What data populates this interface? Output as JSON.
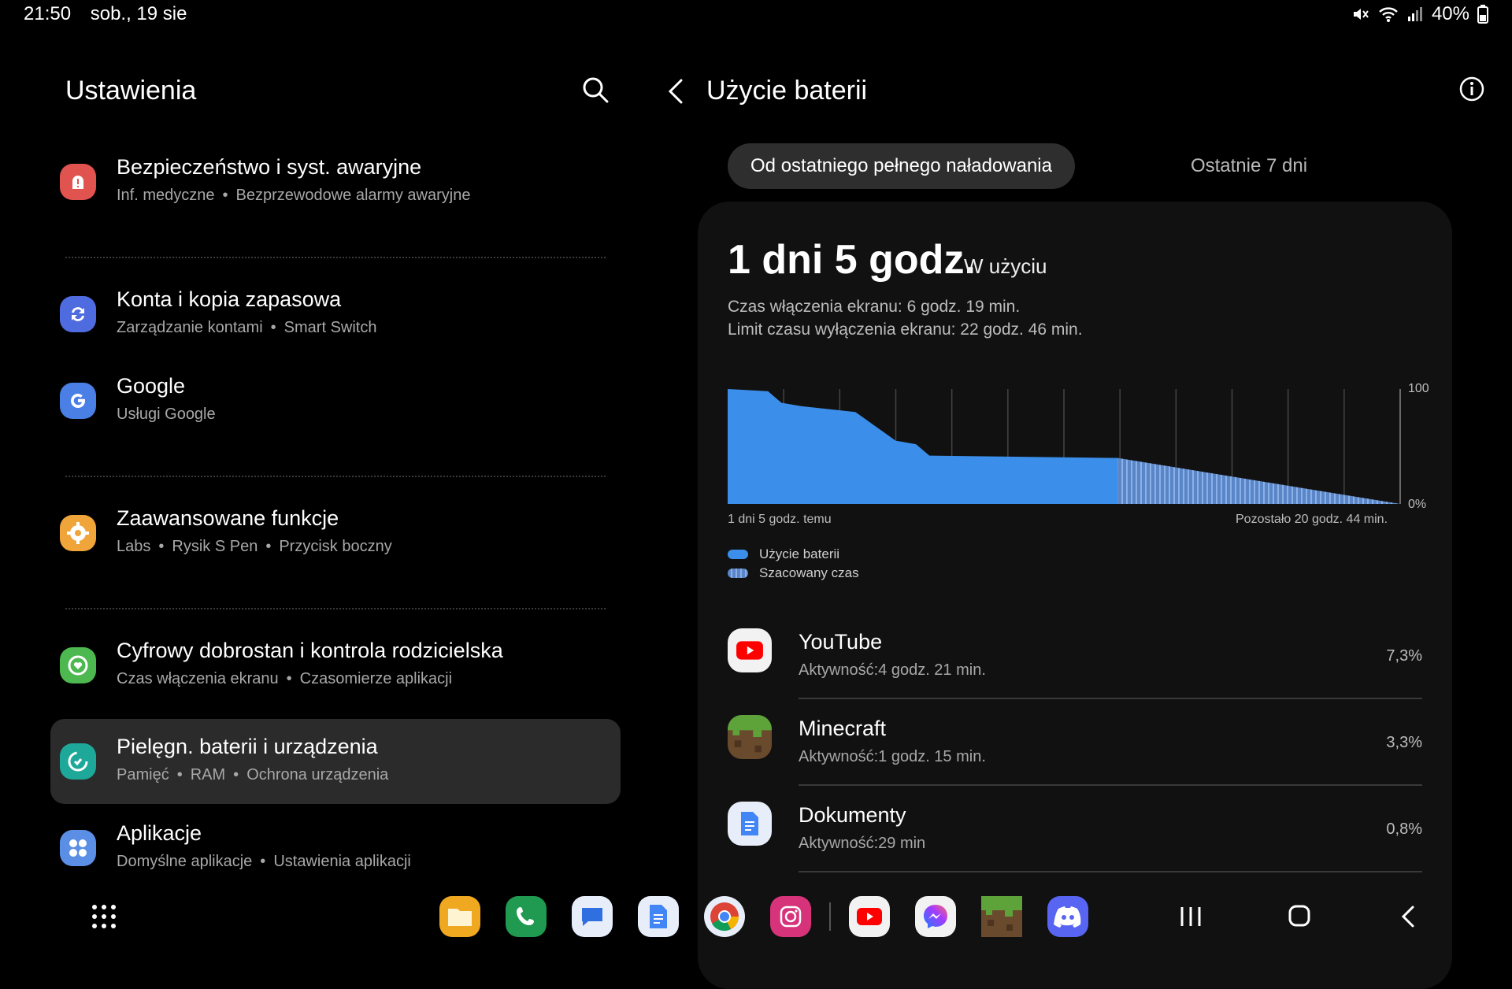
{
  "status": {
    "time": "21:50",
    "date": "sob., 19 sie",
    "battery": "40%",
    "icons": [
      "mute-icon",
      "wifi-icon",
      "signal-icon",
      "battery-icon"
    ]
  },
  "left": {
    "title": "Ustawienia",
    "search_icon": "search-icon",
    "items": [
      {
        "title": "Bezpieczeństwo i syst. awaryjne",
        "subs": [
          "Inf. medyczne",
          "Bezprzewodowe alarmy awaryjne"
        ],
        "icon": "emergency-icon",
        "color": "#e0534f"
      },
      {
        "title": "Konta i kopia zapasowa",
        "subs": [
          "Zarządzanie kontami",
          "Smart Switch"
        ],
        "icon": "sync-icon",
        "color": "#4f6be0"
      },
      {
        "title": "Google",
        "subs": [
          "Usługi Google"
        ],
        "icon": "google-icon",
        "color": "#4a7fe6"
      },
      {
        "title": "Zaawansowane funkcje",
        "subs": [
          "Labs",
          "Rysik S Pen",
          "Przycisk boczny"
        ],
        "icon": "gear-plus-icon",
        "color": "#f0a53a"
      },
      {
        "title": "Cyfrowy dobrostan i kontrola rodzicielska",
        "subs": [
          "Czas włączenia ekranu",
          "Czasomierze aplikacji"
        ],
        "icon": "wellbeing-icon",
        "color": "#4cb84f"
      },
      {
        "title": "Pielęgn. baterii i urządzenia",
        "subs": [
          "Pamięć",
          "RAM",
          "Ochrona urządzenia"
        ],
        "icon": "device-care-icon",
        "color": "#1ea89a"
      },
      {
        "title": "Aplikacje",
        "subs": [
          "Domyślne aplikacje",
          "Ustawienia aplikacji"
        ],
        "icon": "apps-icon",
        "color": "#5b8fe6"
      }
    ]
  },
  "right": {
    "title": "Użycie baterii",
    "tabs": [
      "Od ostatniego pełnego naładowania",
      "Ostatnie 7 dni"
    ],
    "usage_big": "1 dni 5 godz.",
    "usage_label": "W użyciu",
    "screen_on": "Czas włączenia ekranu: 6 godz. 19 min.",
    "screen_off": "Limit czasu wyłączenia ekranu: 22 godz. 46 min.",
    "chart_left_label": "1 dni 5 godz. temu",
    "chart_right_label": "Pozostało 20 godz. 44 min.",
    "y_top": "100",
    "y_bottom": "0%",
    "legend_usage": "Użycie baterii",
    "legend_estimate": "Szacowany czas",
    "apps": [
      {
        "name": "YouTube",
        "activity": "Aktywność:4 godz. 21 min.",
        "percent": "7,3%",
        "icon": "youtube-icon"
      },
      {
        "name": "Minecraft",
        "activity": "Aktywność:1 godz. 15 min.",
        "percent": "3,3%",
        "icon": "minecraft-icon"
      },
      {
        "name": "Dokumenty",
        "activity": "Aktywność:29 min",
        "percent": "0,8%",
        "icon": "docs-icon"
      }
    ]
  },
  "chart_data": {
    "type": "area",
    "ylim": [
      0,
      100
    ],
    "series": [
      {
        "name": "Użycie baterii",
        "points": [
          [
            0,
            100
          ],
          [
            0.06,
            98
          ],
          [
            0.08,
            88
          ],
          [
            0.11,
            85
          ],
          [
            0.19,
            80
          ],
          [
            0.25,
            55
          ],
          [
            0.28,
            52
          ],
          [
            0.3,
            42
          ],
          [
            0.58,
            40
          ]
        ]
      },
      {
        "name": "Szacowany czas",
        "points": [
          [
            0.58,
            40
          ],
          [
            1.0,
            0
          ]
        ]
      }
    ],
    "colors": {
      "usage": "#3b8eea",
      "estimate": "#6e97d8"
    }
  },
  "dock": {
    "apps": [
      "files-icon",
      "phone-icon",
      "messages-icon",
      "docs-icon",
      "chrome-icon",
      "instagram-icon",
      "youtube-icon",
      "messenger-icon",
      "minecraft-icon",
      "discord-icon"
    ],
    "nav": [
      "app-drawer-icon",
      "recents-icon",
      "home-icon",
      "back-icon"
    ]
  }
}
